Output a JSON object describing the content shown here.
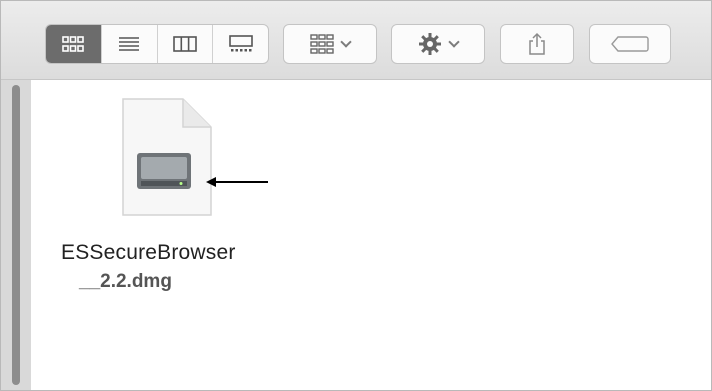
{
  "toolbar": {
    "view_icons": [
      "icon-view-icon",
      "list-view-icon",
      "column-view-icon",
      "gallery-view-icon"
    ],
    "group_button_icon": "grid-group-icon",
    "action_button_icon": "gear-icon",
    "share_button_icon": "share-icon",
    "tag_button_icon": "tag-icon"
  },
  "file": {
    "name_line1": "ESSecureBrowser",
    "name_line2": "__2.2.dmg",
    "icon": "disk-image-icon"
  },
  "colors": {
    "toolbar_bg": "#e4e4e4",
    "active_segment": "#6c6c6c",
    "text": "#222222"
  }
}
